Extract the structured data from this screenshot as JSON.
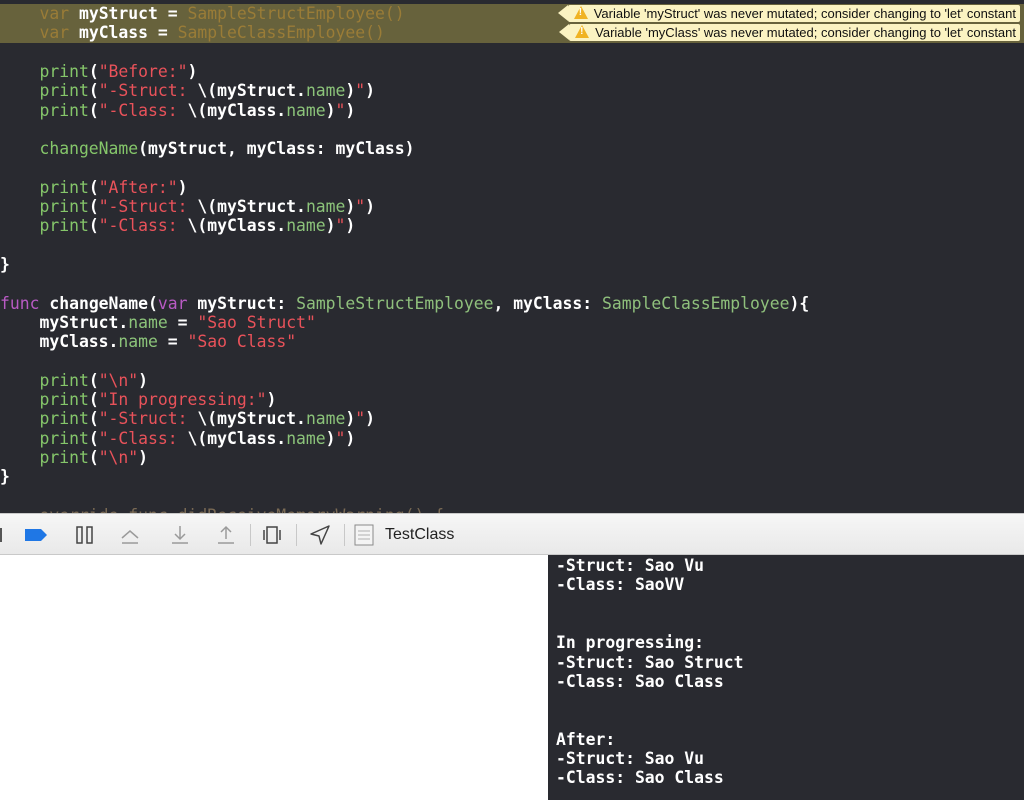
{
  "editor": {
    "lines": [
      {
        "tokens": [
          [
            "dim",
            "    var "
          ],
          [
            "pl",
            "myStruct = "
          ],
          [
            "dim",
            "SampleStructEmployee()"
          ]
        ],
        "highlight": true
      },
      {
        "tokens": [
          [
            "dim",
            "    var "
          ],
          [
            "pl",
            "myClass = "
          ],
          [
            "dim",
            "SampleClassEmployee()"
          ]
        ],
        "highlight": true
      },
      {
        "tokens": []
      },
      {
        "tokens": [
          [
            "fn",
            "    print"
          ],
          [
            "pl",
            "("
          ],
          [
            "st",
            "\"Before:\""
          ],
          [
            "pl",
            ")"
          ]
        ]
      },
      {
        "tokens": [
          [
            "fn",
            "    print"
          ],
          [
            "pl",
            "("
          ],
          [
            "st",
            "\"-Struct: "
          ],
          [
            "pl",
            "\\(myStruct."
          ],
          [
            "pr",
            "name"
          ],
          [
            "pl",
            ")"
          ],
          [
            "st",
            "\""
          ],
          [
            "pl",
            ")"
          ]
        ]
      },
      {
        "tokens": [
          [
            "fn",
            "    print"
          ],
          [
            "pl",
            "("
          ],
          [
            "st",
            "\"-Class: "
          ],
          [
            "pl",
            "\\(myClass."
          ],
          [
            "pr",
            "name"
          ],
          [
            "pl",
            ")"
          ],
          [
            "st",
            "\""
          ],
          [
            "pl",
            ")"
          ]
        ]
      },
      {
        "tokens": []
      },
      {
        "tokens": [
          [
            "fn",
            "    changeName"
          ],
          [
            "pl",
            "(myStruct, myClass: myClass)"
          ]
        ]
      },
      {
        "tokens": []
      },
      {
        "tokens": [
          [
            "fn",
            "    print"
          ],
          [
            "pl",
            "("
          ],
          [
            "st",
            "\"After:\""
          ],
          [
            "pl",
            ")"
          ]
        ]
      },
      {
        "tokens": [
          [
            "fn",
            "    print"
          ],
          [
            "pl",
            "("
          ],
          [
            "st",
            "\"-Struct: "
          ],
          [
            "pl",
            "\\(myStruct."
          ],
          [
            "pr",
            "name"
          ],
          [
            "pl",
            ")"
          ],
          [
            "st",
            "\""
          ],
          [
            "pl",
            ")"
          ]
        ]
      },
      {
        "tokens": [
          [
            "fn",
            "    print"
          ],
          [
            "pl",
            "("
          ],
          [
            "st",
            "\"-Class: "
          ],
          [
            "pl",
            "\\(myClass."
          ],
          [
            "pr",
            "name"
          ],
          [
            "pl",
            ")"
          ],
          [
            "st",
            "\""
          ],
          [
            "pl",
            ")"
          ]
        ]
      },
      {
        "tokens": []
      },
      {
        "tokens": [
          [
            "pl",
            "}"
          ]
        ]
      },
      {
        "tokens": []
      },
      {
        "tokens": [
          [
            "kw",
            "func "
          ],
          [
            "pl",
            "changeName("
          ],
          [
            "kw",
            "var "
          ],
          [
            "pl",
            "myStruct: "
          ],
          [
            "ty",
            "SampleStructEmployee"
          ],
          [
            "pl",
            ", myClass: "
          ],
          [
            "ty",
            "SampleClassEmployee"
          ],
          [
            "pl",
            "){"
          ]
        ]
      },
      {
        "tokens": [
          [
            "pl",
            "    myStruct."
          ],
          [
            "pr",
            "name"
          ],
          [
            "pl",
            " = "
          ],
          [
            "st",
            "\"Sao Struct\""
          ]
        ]
      },
      {
        "tokens": [
          [
            "pl",
            "    myClass."
          ],
          [
            "pr",
            "name"
          ],
          [
            "pl",
            " = "
          ],
          [
            "st",
            "\"Sao Class\""
          ]
        ]
      },
      {
        "tokens": []
      },
      {
        "tokens": [
          [
            "fn",
            "    print"
          ],
          [
            "pl",
            "("
          ],
          [
            "st",
            "\"\\n\""
          ],
          [
            "pl",
            ")"
          ]
        ]
      },
      {
        "tokens": [
          [
            "fn",
            "    print"
          ],
          [
            "pl",
            "("
          ],
          [
            "st",
            "\"In progressing:\""
          ],
          [
            "pl",
            ")"
          ]
        ]
      },
      {
        "tokens": [
          [
            "fn",
            "    print"
          ],
          [
            "pl",
            "("
          ],
          [
            "st",
            "\"-Struct: "
          ],
          [
            "pl",
            "\\(myStruct."
          ],
          [
            "pr",
            "name"
          ],
          [
            "pl",
            ")"
          ],
          [
            "st",
            "\""
          ],
          [
            "pl",
            ")"
          ]
        ]
      },
      {
        "tokens": [
          [
            "fn",
            "    print"
          ],
          [
            "pl",
            "("
          ],
          [
            "st",
            "\"-Class: "
          ],
          [
            "pl",
            "\\(myClass."
          ],
          [
            "pr",
            "name"
          ],
          [
            "pl",
            ")"
          ],
          [
            "st",
            "\""
          ],
          [
            "pl",
            ")"
          ]
        ]
      },
      {
        "tokens": [
          [
            "fn",
            "    print"
          ],
          [
            "pl",
            "("
          ],
          [
            "st",
            "\"\\n\""
          ],
          [
            "pl",
            ")"
          ]
        ]
      },
      {
        "tokens": [
          [
            "pl",
            "}"
          ]
        ]
      },
      {
        "tokens": []
      },
      {
        "tokens": [
          [
            "cut",
            "    override func didReceiveMemoryWarning() {"
          ]
        ]
      }
    ],
    "warnings": [
      {
        "line": 0,
        "text": "Variable 'myStruct' was never mutated; consider changing to 'let' constant"
      },
      {
        "line": 1,
        "text": "Variable 'myClass' was never mutated; consider changing to 'let' constant"
      }
    ]
  },
  "debugbar": {
    "scheme": "TestClass",
    "accent": "#1f77e5"
  },
  "console": {
    "lines": [
      "-Struct: Sao Vu",
      "-Class: SaoVV",
      "",
      "",
      "In progressing:",
      "-Struct: Sao Struct",
      "-Class: Sao Class",
      "",
      "",
      "After:",
      "-Struct: Sao Vu",
      "-Class: Sao Class"
    ]
  }
}
